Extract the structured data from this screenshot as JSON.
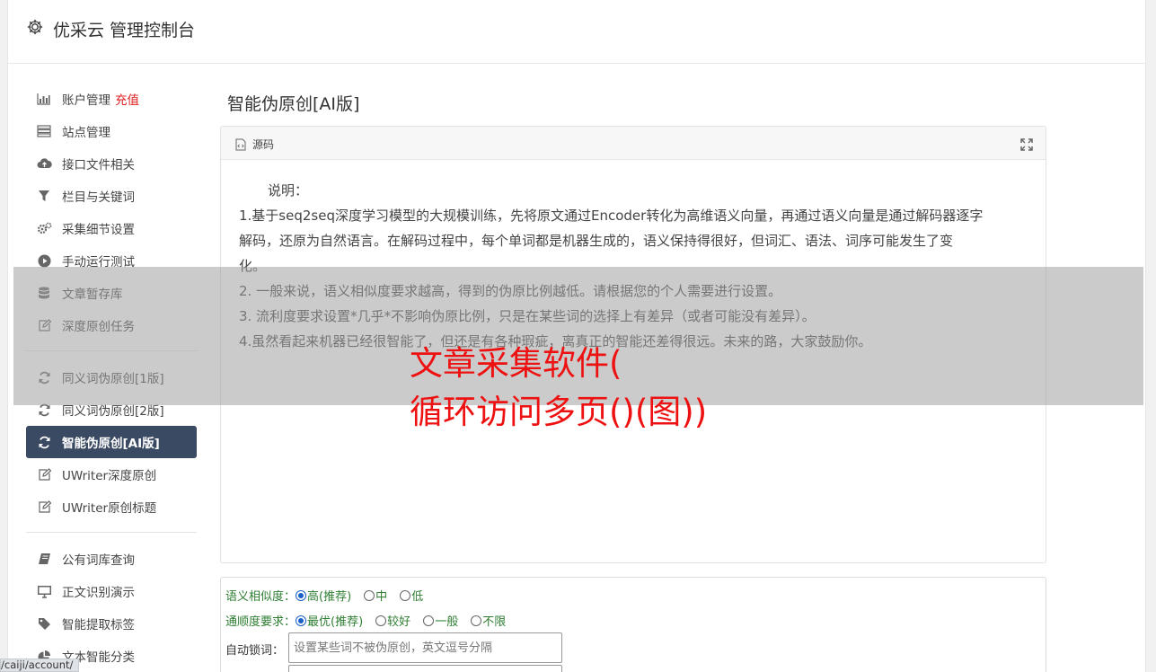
{
  "header": {
    "title": "优采云 管理控制台"
  },
  "sidebar": {
    "group1": [
      {
        "label": "账户管理",
        "badge": "充值",
        "icon": "bar-chart-icon"
      },
      {
        "label": "站点管理",
        "icon": "server-icon"
      },
      {
        "label": "接口文件相关",
        "icon": "cloud-upload-icon"
      },
      {
        "label": "栏目与关键词",
        "icon": "filter-icon"
      },
      {
        "label": "采集细节设置",
        "icon": "cogs-icon"
      },
      {
        "label": "手动运行测试",
        "icon": "play-circle-icon"
      },
      {
        "label": "文章暂存库",
        "icon": "database-icon"
      },
      {
        "label": "深度原创任务",
        "icon": "edit-icon"
      }
    ],
    "group2": [
      {
        "label": "同义词伪原创[1版]",
        "icon": "refresh-icon"
      },
      {
        "label": "同义词伪原创[2版]",
        "icon": "refresh-icon"
      },
      {
        "label": "智能伪原创[AI版]",
        "icon": "refresh-icon",
        "active": true
      },
      {
        "label": "UWriter深度原创",
        "icon": "edit-icon"
      },
      {
        "label": "UWriter原创标题",
        "icon": "edit-icon"
      }
    ],
    "group3": [
      {
        "label": "公有词库查询",
        "icon": "book-icon"
      },
      {
        "label": "正文识别演示",
        "icon": "monitor-icon"
      },
      {
        "label": "智能提取标签",
        "icon": "tag-icon"
      },
      {
        "label": "文本智能分类",
        "icon": "pie-chart-icon"
      }
    ]
  },
  "main": {
    "title": "智能伪原创[AI版]",
    "panel_label": "源码",
    "note_title": "说明：",
    "lines": [
      "1.基于seq2seq深度学习模型的大规模训练，先将原文通过Encoder转化为高维语义向量，再通过语义向量是通过解码器逐字",
      "解码，还原为自然语言。在解码过程中，每个单词都是机器生成的，语义保持得很好，但词汇、语法、词序可能发生了变",
      "化。",
      "2. 一般来说，语义相似度要求越高，得到的伪原比例越低。请根据您的个人需要进行设置。",
      "3. 流利度要求设置*几乎*不影响伪原比例，只是在某些词的选择上有差异（或者可能没有差异）。",
      "4.虽然看起来机器已经很智能了，但还是有各种瑕疵，离真正的智能还差得很远。未来的路，大家鼓励你。"
    ]
  },
  "form": {
    "similarity_label": "语义相似度：",
    "similarity_options": [
      "高(推荐)",
      "中",
      "低"
    ],
    "fluency_label": "通顺度要求：",
    "fluency_options": [
      "最优(推荐)",
      "较好",
      "一般",
      "不限"
    ],
    "lock_label": "自动锁词：",
    "lock_placeholder": "设置某些词不被伪原创，英文逗号分隔"
  },
  "overlay": {
    "line1": "文章采集软件(",
    "line2": "循环访问多页()(图))"
  },
  "statusbar": {
    "url": "/caiji/account/"
  },
  "colors": {
    "active_nav": "#3a4a63",
    "recharge": "#e02020",
    "overlay_text": "#ee1111",
    "form_label": "#2e7d32"
  }
}
